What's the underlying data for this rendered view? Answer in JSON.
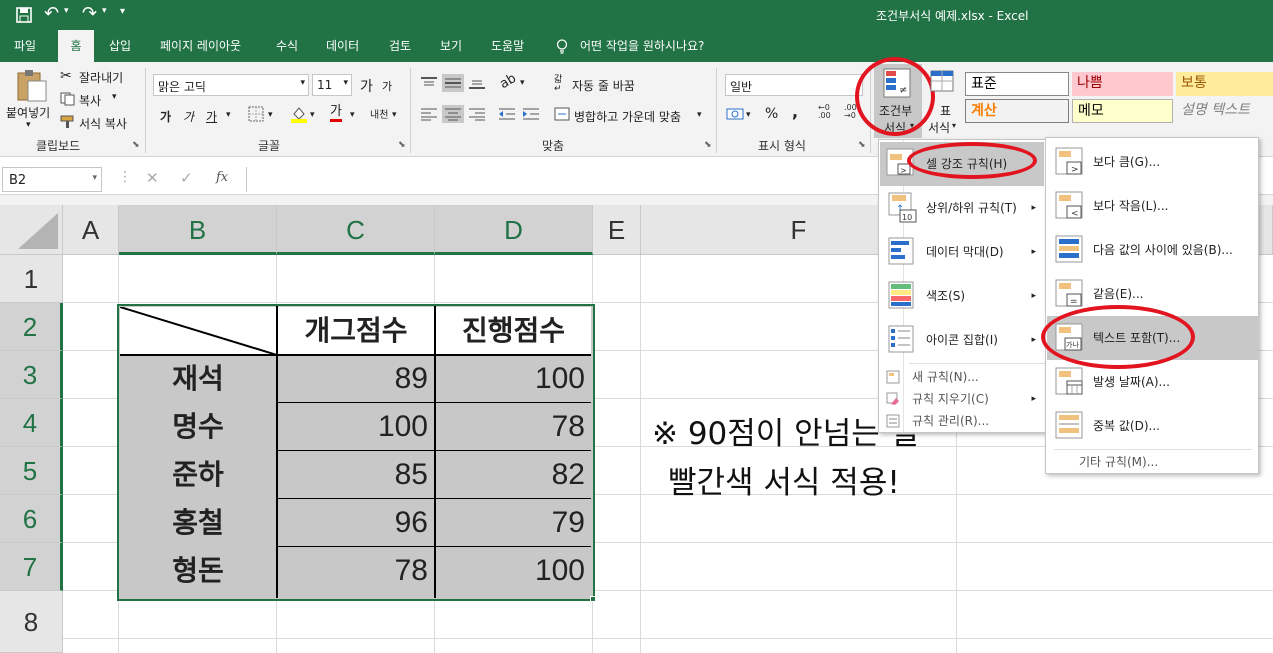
{
  "window": {
    "title": "조건부서식 예제.xlsx - Excel"
  },
  "qat": {
    "save": "save-icon",
    "undo": "↶",
    "redo": "↷",
    "more": "▾"
  },
  "tabs": [
    "파일",
    "홈",
    "삽입",
    "페이지 레이아웃",
    "수식",
    "데이터",
    "검토",
    "보기",
    "도움말"
  ],
  "tellme": "어떤 작업을 원하시나요?",
  "clipboard": {
    "paste": "붙여넣기",
    "cut": "잘라내기",
    "copy": "복사",
    "format_painter": "서식 복사",
    "label": "클립보드"
  },
  "font": {
    "name": "맑은 고딕",
    "size": "11",
    "grow": "가",
    "shrink": "가",
    "bold": "가",
    "italic": "가",
    "underline": "가",
    "fill_icon": "fill-color-icon",
    "font_color": "가",
    "phonetic": "내천",
    "label": "글꼴"
  },
  "alignment": {
    "wrap": "자동 줄 바꿈",
    "merge": "병합하고 가운데 맞춤",
    "label": "맞춤"
  },
  "number": {
    "format": "일반",
    "percent": "%",
    "comma": ",",
    "label": "표시 형식"
  },
  "cond": {
    "label1": "조건부",
    "label2": "서식",
    "table_label": "표",
    "table_label2": "서식"
  },
  "styles": {
    "normal": "표준",
    "bad": "나쁨",
    "neutral": "보통",
    "calc": "계산",
    "note": "메모",
    "explain": "설명 텍스트"
  },
  "namebox": "B2",
  "fx": "fx",
  "columns": [
    "A",
    "B",
    "C",
    "D",
    "E",
    "F"
  ],
  "rows": [
    "1",
    "2",
    "3",
    "4",
    "5",
    "6",
    "7",
    "8"
  ],
  "table": {
    "headers": [
      "개그점수",
      "진행점수"
    ],
    "data": [
      {
        "name": "재석",
        "c": "89",
        "d": "100"
      },
      {
        "name": "명수",
        "c": "100",
        "d": "78"
      },
      {
        "name": "준하",
        "c": "85",
        "d": "82"
      },
      {
        "name": "홍철",
        "c": "96",
        "d": "79"
      },
      {
        "name": "형돈",
        "c": "78",
        "d": "100"
      }
    ]
  },
  "note": {
    "line1": "※ 90점이 안넘는 셀",
    "line2": "빨간색 서식 적용!"
  },
  "menu": {
    "items": [
      "셀 강조 규칙(H)",
      "상위/하위 규칙(T)",
      "데이터 막대(D)",
      "색조(S)",
      "아이콘 집합(I)"
    ],
    "small": [
      "새 규칙(N)...",
      "규칙 지우기(C)",
      "규칙 관리(R)..."
    ]
  },
  "submenu": {
    "items": [
      "보다 큼(G)...",
      "보다 작음(L)...",
      "다음 값의 사이에 있음(B)...",
      "같음(E)...",
      "텍스트 포함(T)...",
      "발생 날짜(A)...",
      "중복 값(D)..."
    ],
    "more": "기타 규칙(M)..."
  },
  "colors": {
    "accent": "#217346",
    "highlight_ring": "#e2141f",
    "selected_fill": "#c8c8c8"
  }
}
